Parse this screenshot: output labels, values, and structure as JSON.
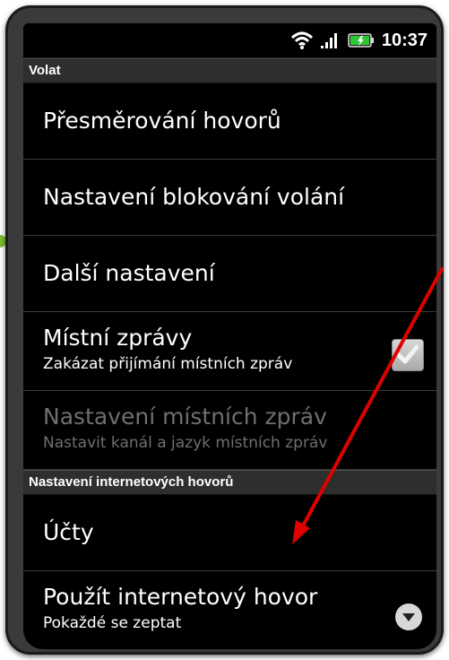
{
  "status": {
    "time": "10:37"
  },
  "sections": [
    {
      "header": "Volat"
    },
    {
      "header": "Nastavení internetových hovorů"
    }
  ],
  "items": [
    {
      "title": "Přesměrování hovorů"
    },
    {
      "title": "Nastavení blokování volání"
    },
    {
      "title": "Další nastavení"
    },
    {
      "title": "Místní zprávy",
      "subtitle": "Zakázat přijímání místních zpráv",
      "checked": true
    },
    {
      "title": "Nastavení místních zpráv",
      "subtitle": "Nastavit kanál a jazyk místních zpráv",
      "disabled": true
    },
    {
      "title": "Účty"
    },
    {
      "title": "Použít internetový hovor",
      "subtitle": "Pokaždé se zeptat"
    }
  ],
  "colors": {
    "annotation_arrow": "#e00000",
    "accent_green": "#2fc72f"
  },
  "icons": [
    "wifi-icon",
    "signal-icon",
    "battery-icon",
    "checkmark-icon",
    "chevron-down-icon"
  ]
}
